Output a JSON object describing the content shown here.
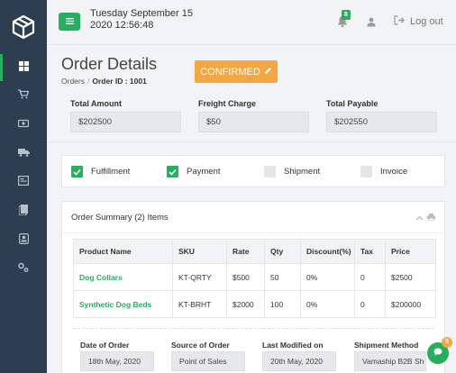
{
  "sidebar": {
    "logo_icon": "cube-logo-icon",
    "items": [
      {
        "icon": "dashboard-icon",
        "active": true
      },
      {
        "icon": "cart-icon",
        "active": false
      },
      {
        "icon": "cash-icon",
        "active": false
      },
      {
        "icon": "truck-icon",
        "active": false
      },
      {
        "icon": "invoice-icon",
        "active": false
      },
      {
        "icon": "document-icon",
        "active": false
      },
      {
        "icon": "user-card-icon",
        "active": false
      },
      {
        "icon": "settings-icon",
        "active": false
      }
    ]
  },
  "header": {
    "date": "Tuesday September 15",
    "time": "2020 12:56:48",
    "notification_count": "8",
    "logout_label": "Log out"
  },
  "order": {
    "title": "Order Details",
    "breadcrumb_root": "Orders",
    "breadcrumb_current": "Order ID : 1001",
    "status": "CONFIRMED"
  },
  "amounts": {
    "total_amount_label": "Total Amount",
    "total_amount": "$202500",
    "freight_label": "Freight Charge",
    "freight": "$50",
    "payable_label": "Total Payable",
    "payable": "$202550"
  },
  "checklist": [
    {
      "label": "Fulfillment",
      "checked": true
    },
    {
      "label": "Payment",
      "checked": true
    },
    {
      "label": "Shipment",
      "checked": false
    },
    {
      "label": "Invoice",
      "checked": false
    }
  ],
  "summary": {
    "title": "Order Summary (2) Items",
    "columns": [
      "Product Name",
      "SKU",
      "Rate",
      "Qty",
      "Discount(%)",
      "Tax",
      "Price"
    ],
    "rows": [
      [
        "Dog Collars",
        "KT-QRTY",
        "$500",
        "50",
        "0%",
        "0",
        "$2500"
      ],
      [
        "Synthetic Dog Beds",
        "KT-BRHT",
        "$2000",
        "100",
        "0%",
        "0",
        "$200000"
      ]
    ]
  },
  "meta": {
    "date_label": "Date of Order",
    "date": "18th May, 2020",
    "source_label": "Source of Order",
    "source": "Point of Sales",
    "modified_label": "Last Modified on",
    "modified": "20th May, 2020",
    "shipment_label": "Shipment Method",
    "shipment": "Vamaship B2B Sh"
  },
  "chat": {
    "badge": "5"
  },
  "colors": {
    "sidebar": "#2c3e50",
    "accent": "#27ae60",
    "status": "#f5a742"
  }
}
